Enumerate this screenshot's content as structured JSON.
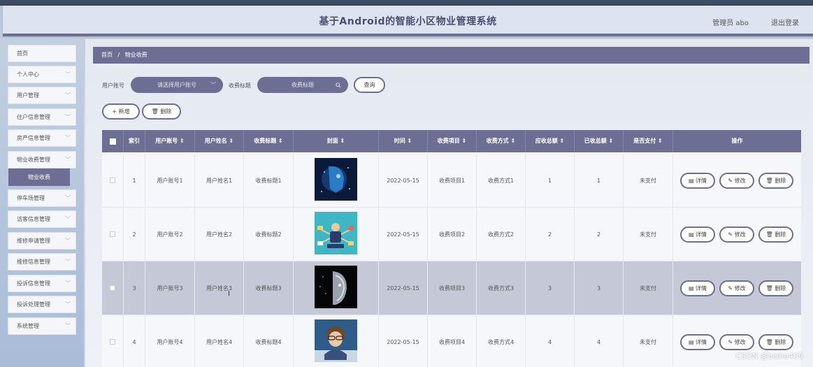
{
  "header": {
    "title": "基于Android的智能小区物业管理系统",
    "user": "管理员 abo",
    "logout": "退出登录"
  },
  "sidebar": {
    "items": [
      {
        "label": "首页",
        "chevron": false
      },
      {
        "label": "个人中心",
        "chevron": true
      },
      {
        "label": "用户管理",
        "chevron": true
      },
      {
        "label": "住户信息管理",
        "chevron": true
      },
      {
        "label": "房产信息管理",
        "chevron": true
      },
      {
        "label": "物业收费管理",
        "chevron": true
      },
      {
        "label": "停车场管理",
        "chevron": true
      },
      {
        "label": "访客信息管理",
        "chevron": true
      },
      {
        "label": "维修申请管理",
        "chevron": true
      },
      {
        "label": "维修信息管理",
        "chevron": true
      },
      {
        "label": "投诉信息管理",
        "chevron": true
      },
      {
        "label": "投诉处理管理",
        "chevron": true
      },
      {
        "label": "系统管理",
        "chevron": true
      }
    ],
    "sub_active": "物业收费"
  },
  "breadcrumb": {
    "home": "首页",
    "sep": "/",
    "current": "物业收费"
  },
  "search": {
    "user_label": "用户账号",
    "user_placeholder": "请选择用户账号",
    "title_label": "收费标题",
    "title_placeholder": "收费标题",
    "query_button": "查询"
  },
  "toolbar": {
    "add_label": "+ 新增",
    "delete_label": "删除"
  },
  "table": {
    "headers": [
      "索引",
      "用户账号 ⇕",
      "用户姓名 ⇕",
      "收费标题 ⇕",
      "封面 ⇕",
      "时间 ⇕",
      "收费项目 ⇕",
      "收费方式 ⇕",
      "应收总额 ⇕",
      "已收总额 ⇕",
      "是否支付 ⇕",
      "操作"
    ],
    "rows": [
      {
        "index": "1",
        "account": "用户账号1",
        "name": "用户姓名1",
        "title": "收费标题1",
        "time": "2022-05-15",
        "item": "收费项目1",
        "method": "收费方式1",
        "due": "1",
        "paid": "1",
        "status": "未支付"
      },
      {
        "index": "2",
        "account": "用户账号2",
        "name": "用户姓名2",
        "title": "收费标题2",
        "time": "2022-05-15",
        "item": "收费项目2",
        "method": "收费方式2",
        "due": "2",
        "paid": "2",
        "status": "未支付"
      },
      {
        "index": "3",
        "account": "用户账号3",
        "name": "用户姓名3",
        "title": "收费标题3",
        "time": "2022-05-15",
        "item": "收费项目3",
        "method": "收费方式3",
        "due": "3",
        "paid": "3",
        "status": "未支付"
      },
      {
        "index": "4",
        "account": "用户账号4",
        "name": "用户姓名4",
        "title": "收费标题4",
        "time": "2022-05-15",
        "item": "收费项目4",
        "method": "收费方式4",
        "due": "4",
        "paid": "4",
        "status": "未支付"
      }
    ],
    "actions": {
      "detail": "详情",
      "edit": "修改",
      "delete": "删除"
    }
  },
  "watermark": "CSDN @bishe409",
  "colors": {
    "accent": "#6c6e94",
    "selected_row": "#c5c8d6"
  }
}
